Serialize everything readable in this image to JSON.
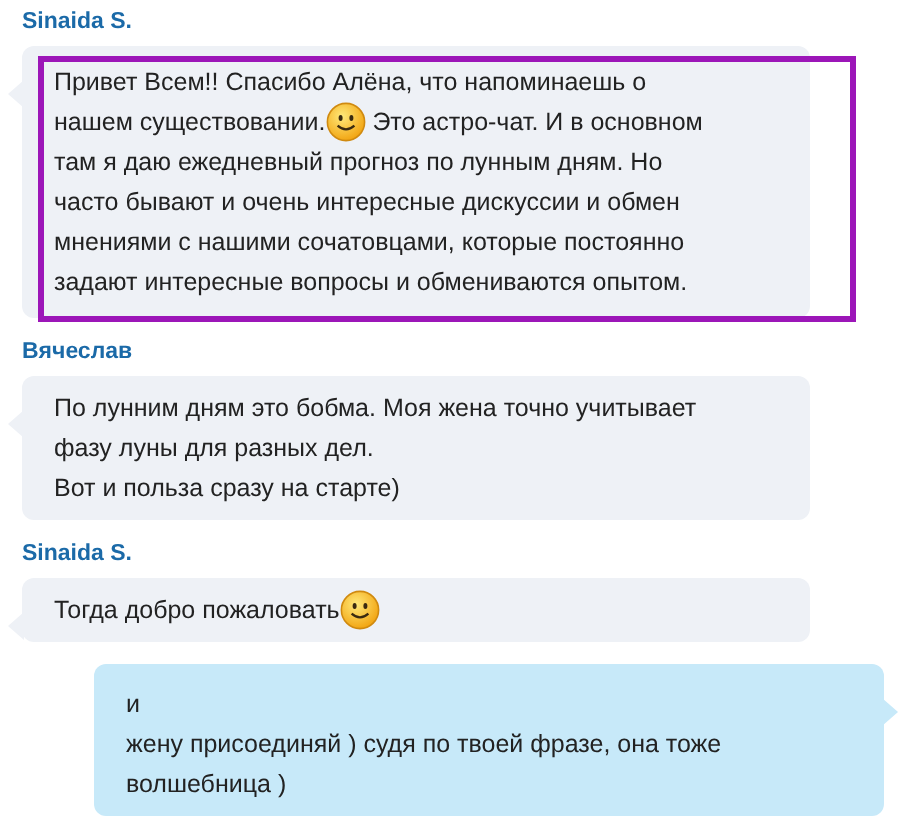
{
  "messages": [
    {
      "sender": "Sinaida S.",
      "kind": "incoming",
      "highlighted": true,
      "lines": [
        [
          {
            "kind": "text",
            "text": "Привет Всем!! Спасибо Алёна, что напоминаешь о"
          }
        ],
        [
          {
            "kind": "text",
            "text": "нашем существовании."
          },
          {
            "kind": "emoji"
          },
          {
            "kind": "text",
            "text": " Это астро-чат. И в основном"
          }
        ],
        [
          {
            "kind": "text",
            "text": "там я даю ежедневный прогноз по лунным дням. Но"
          }
        ],
        [
          {
            "kind": "text",
            "text": "часто бывают и очень интересные дискуссии и обмен"
          }
        ],
        [
          {
            "kind": "text",
            "text": "мнениями с нашими сочатовцами, которые постоянно"
          }
        ],
        [
          {
            "kind": "text",
            "text": "задают интересные вопросы и обмениваются опытом."
          }
        ]
      ]
    },
    {
      "sender": "Вячеслав",
      "kind": "incoming",
      "highlighted": false,
      "lines": [
        [
          {
            "kind": "text",
            "text": "По лунним дням это бобма. Моя жена точно учитывает"
          }
        ],
        [
          {
            "kind": "text",
            "text": "фазу луны для разных дел."
          }
        ],
        [
          {
            "kind": "text",
            "text": "Вот и польза сразу на старте)"
          }
        ]
      ]
    },
    {
      "sender": "Sinaida S.",
      "kind": "incoming",
      "highlighted": false,
      "lines": [
        [
          {
            "kind": "text",
            "text": "Тогда добро пожаловать"
          },
          {
            "kind": "emoji"
          }
        ]
      ]
    },
    {
      "kind": "outgoing",
      "highlighted": false,
      "lines": [
        [
          {
            "kind": "text",
            "text": "и"
          }
        ],
        [
          {
            "kind": "text",
            "text": "жену присоединяй ) судя по твоей фразе, она тоже"
          }
        ],
        [
          {
            "kind": "text",
            "text": "волшебница )"
          }
        ]
      ]
    }
  ]
}
